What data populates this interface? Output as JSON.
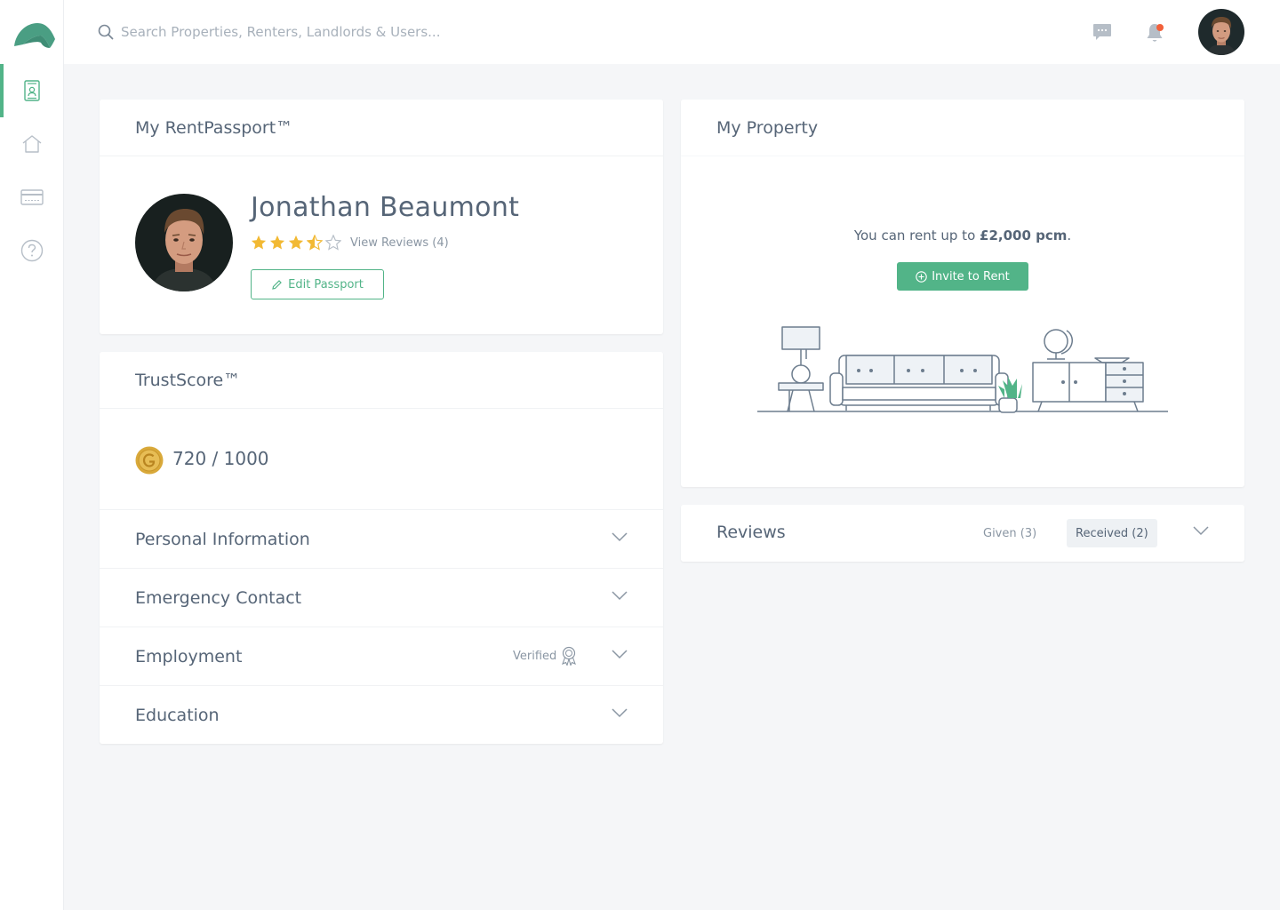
{
  "app": {
    "logo_icon": "brand-arch-logo",
    "accent": "#52b488",
    "notification_dot": "#f2603a"
  },
  "sidebar": {
    "items": [
      {
        "icon": "passport-icon",
        "active": true
      },
      {
        "icon": "home-icon",
        "active": false
      },
      {
        "icon": "card-icon",
        "active": false
      },
      {
        "icon": "help-icon",
        "active": false
      }
    ]
  },
  "search": {
    "placeholder": "Search Properties, Renters, Landlords & Users..."
  },
  "passport": {
    "title": "My RentPassport™",
    "name": "Jonathan Beaumont",
    "rating": 3.5,
    "rating_max": 5,
    "view_reviews": "View Reviews (4)",
    "edit_label": "Edit Passport"
  },
  "trustscore": {
    "title": "TrustScore™",
    "score": "720 / 1000",
    "sections": [
      {
        "label": "Personal Information"
      },
      {
        "label": "Emergency Contact"
      },
      {
        "label": "Employment",
        "badge": "Verified"
      },
      {
        "label": "Education"
      }
    ]
  },
  "property": {
    "title": "My Property",
    "rent_prefix": "You can rent up to ",
    "rent_amount": "£2,000 pcm",
    "rent_suffix": ".",
    "invite_label": "Invite to Rent"
  },
  "reviews": {
    "title": "Reviews",
    "given": "Given (3)",
    "received": "Received (2)"
  }
}
